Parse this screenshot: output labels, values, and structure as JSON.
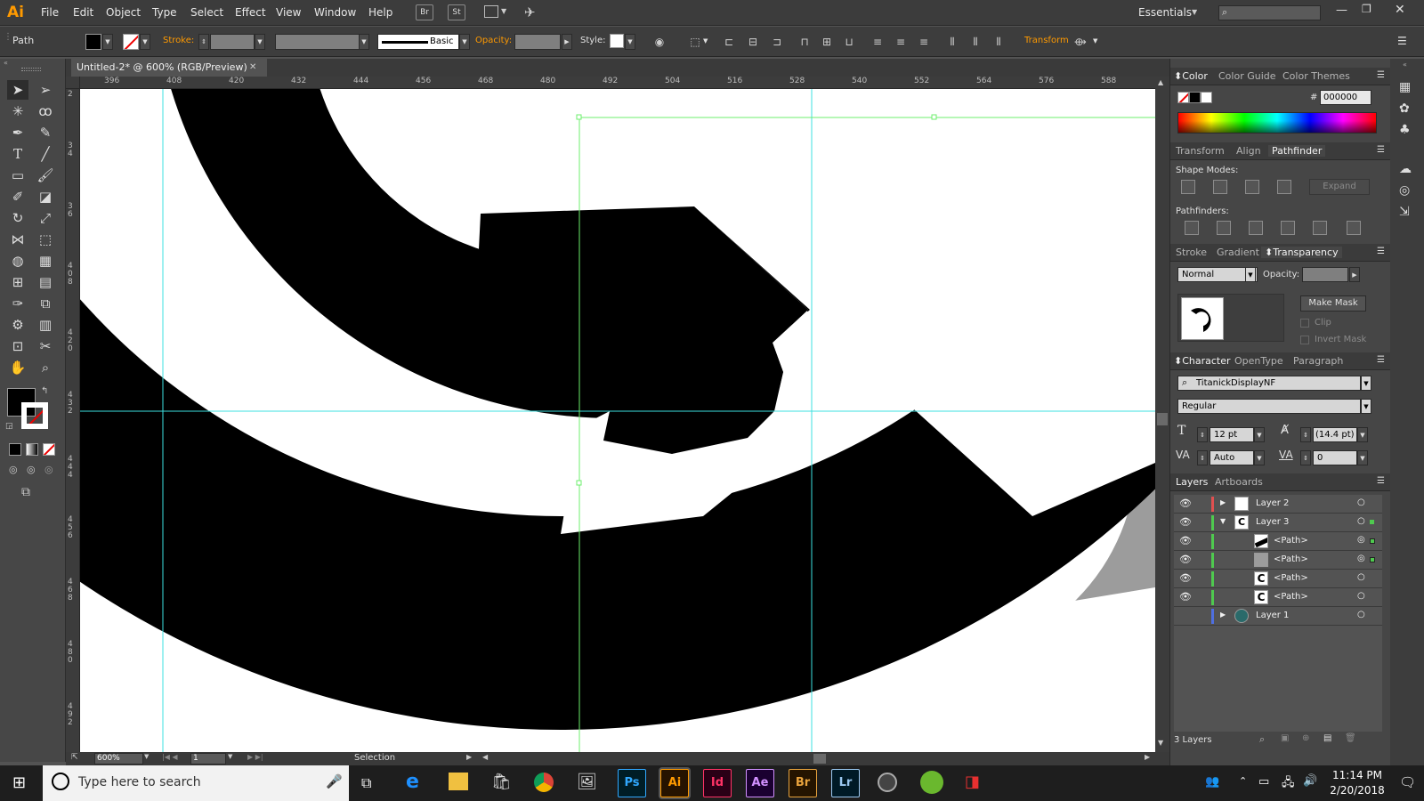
{
  "app": {
    "logo": "Ai",
    "workspace": "Essentials"
  },
  "menu": [
    "File",
    "Edit",
    "Object",
    "Type",
    "Select",
    "Effect",
    "View",
    "Window",
    "Help"
  ],
  "toolbar_icons": {
    "bridge": "Br",
    "stock": "St"
  },
  "control": {
    "selection_type": "Path",
    "stroke_label": "Stroke:",
    "brush": "Basic",
    "opacity_label": "Opacity:",
    "style_label": "Style:",
    "transform_label": "Transform"
  },
  "document": {
    "tab_title": "Untitled-2* @ 600% (RGB/Preview)"
  },
  "rulers": {
    "horizontal": [
      "396",
      "408",
      "420",
      "432",
      "444",
      "456",
      "468",
      "480",
      "492",
      "504",
      "516",
      "528",
      "540",
      "552",
      "564",
      "576",
      "588"
    ],
    "vertical": [
      "2",
      "3 4",
      "3 6",
      "4 0 8",
      "4 2 0",
      "4 3 2",
      "4 4 4",
      "4 5 6",
      "4 6 8",
      "4 8 0",
      "4 9 2"
    ]
  },
  "status": {
    "zoom": "600%",
    "artboard": "1",
    "tool": "Selection"
  },
  "color_panel": {
    "tabs": [
      "Color",
      "Color Guide",
      "Color Themes"
    ],
    "hex_label": "#",
    "hex": "000000"
  },
  "pathfinder_panel": {
    "tabs": [
      "Transform",
      "Align",
      "Pathfinder"
    ],
    "shape_modes": "Shape Modes:",
    "expand": "Expand",
    "pathfinders": "Pathfinders:"
  },
  "transparency_panel": {
    "tabs": [
      "Stroke",
      "Gradient",
      "Transparency"
    ],
    "blend": "Normal",
    "opacity_label": "Opacity:",
    "make_mask": "Make Mask",
    "clip": "Clip",
    "invert": "Invert Mask"
  },
  "character_panel": {
    "tabs": [
      "Character",
      "OpenType",
      "Paragraph"
    ],
    "font": "TitanickDisplayNF",
    "style": "Regular",
    "size": "12 pt",
    "leading": "(14.4 pt)",
    "kerning": "Auto",
    "tracking": "0"
  },
  "layers_panel": {
    "tabs": [
      "Layers",
      "Artboards"
    ],
    "rows": [
      {
        "name": "Layer 2",
        "indent": 0,
        "expanded": false,
        "color": "#e05050"
      },
      {
        "name": "Layer 3",
        "indent": 0,
        "expanded": true,
        "color": "#4fc94f"
      },
      {
        "name": "<Path>",
        "indent": 1,
        "color": "#4fc94f"
      },
      {
        "name": "<Path>",
        "indent": 1,
        "color": "#4fc94f"
      },
      {
        "name": "<Path>",
        "indent": 1,
        "color": "#4fc94f"
      },
      {
        "name": "<Path>",
        "indent": 1,
        "color": "#4fc94f"
      },
      {
        "name": "Layer 1",
        "indent": 0,
        "expanded": false,
        "color": "#4f6fe0"
      }
    ],
    "count": "3 Layers"
  },
  "taskbar": {
    "search_placeholder": "Type here to search",
    "apps": [
      "Ps",
      "Ai",
      "Id",
      "Ae",
      "Br",
      "Lr"
    ],
    "time": "11:14 PM",
    "date": "2/20/2018"
  },
  "colors": {
    "accent": "#ff9a00",
    "guide": "#3de0e0",
    "selection": "#6cef6c"
  }
}
